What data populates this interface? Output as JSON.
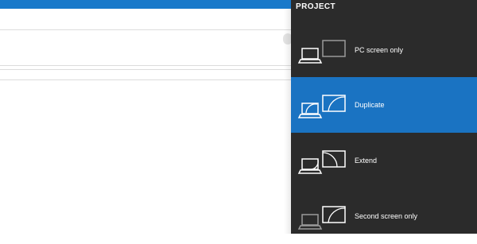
{
  "project_pane": {
    "title": "PROJECT",
    "options": [
      {
        "label": "PC screen only",
        "icon": "pc-screen-only-icon",
        "selected": false
      },
      {
        "label": "Duplicate",
        "icon": "duplicate-icon",
        "selected": true
      },
      {
        "label": "Extend",
        "icon": "extend-icon",
        "selected": false
      },
      {
        "label": "Second screen only",
        "icon": "second-screen-only-icon",
        "selected": false
      }
    ]
  },
  "colors": {
    "pane_background": "#2b2b2b",
    "selected_background": "#1a73c2",
    "titlebar": "#1979ca"
  }
}
